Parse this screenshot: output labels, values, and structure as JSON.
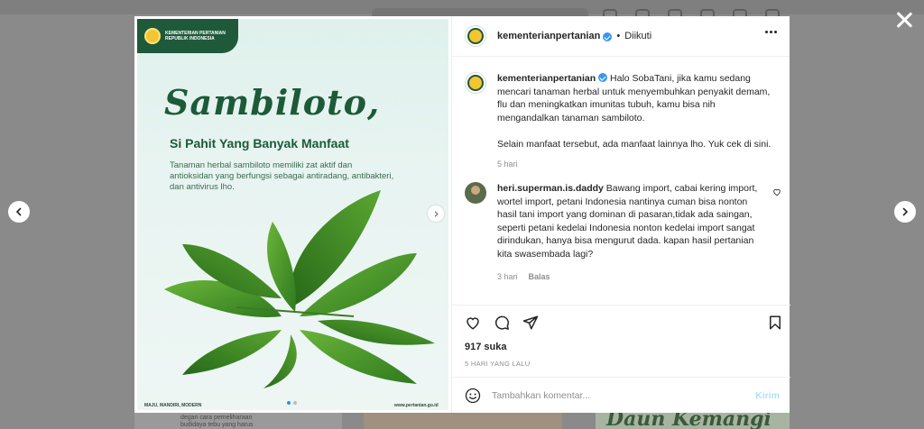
{
  "post": {
    "username": "kementerianpertanian",
    "separator": "•",
    "follow_status": "Diikuti",
    "caption_text": "Halo SobaTani, jika kamu sedang mencari tanaman herbal untuk menyembuhkan penyakit demam, flu dan meningkatkan imunitas tubuh, kamu bisa nih mengandalkan tanaman sambiloto.",
    "caption_text_2": "Selain manfaat tersebut, ada manfaat lainnya lho. Yuk cek di sini.",
    "caption_time": "5 hari",
    "likes": "917 suka",
    "date": "5 HARI YANG LALU"
  },
  "comment": {
    "username": "heri.superman.is.daddy",
    "text": "Bawang import, cabai kering import, wortel import, petani Indonesia nantinya cuman bisa nonton hasil tani import yang dominan di pasaran,tidak ada saingan, seperti petani kedelai Indonesia nonton kedelai import sangat dirindukan, hanya bisa mengurut dada. kapan hasil pertanian kita swasembada lagi?",
    "time": "3 hari",
    "reply_label": "Balas"
  },
  "add_comment": {
    "placeholder": "Tambahkan komentar...",
    "post_label": "Kirim"
  },
  "poster": {
    "logo_line1": "KEMENTERIAN PERTANIAN",
    "logo_line2": "REPUBLIK INDONESIA",
    "title": "Sambiloto,",
    "subtitle": "Si Pahit Yang Banyak Manfaat",
    "description": "Tanaman herbal sambiloto memiliki zat aktif dan antioksidan yang berfungsi sebagai antiradang, antibakteri, dan antivirus lho.",
    "footer_left": "MAJU, MANDIRI, MODERN",
    "footer_right": "www.pertanian.go.id"
  },
  "background": {
    "card_text": "degan cara pemeliharaan budidaya tebu yang harus kamu tau.",
    "script_text": "Daun Kemangi"
  },
  "icons": {
    "close": "close-icon",
    "prev": "chevron-left-icon",
    "next": "chevron-right-icon",
    "like": "heart-icon",
    "comment": "comment-icon",
    "share": "send-icon",
    "save": "bookmark-icon",
    "emoji": "smiley-icon",
    "more": "more-icon"
  },
  "colors": {
    "verified": "#3897f0",
    "poster_green": "#1d5a38",
    "post_button": "#b2dffc"
  }
}
